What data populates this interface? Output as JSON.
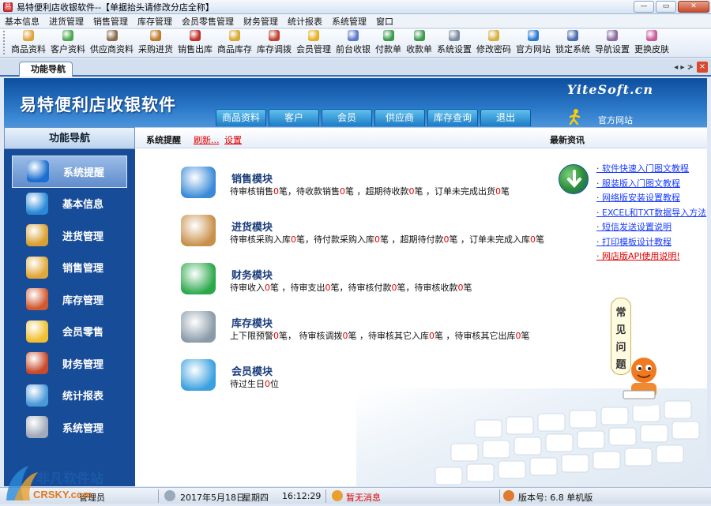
{
  "window": {
    "title": "易特便利店收银软件--【单据抬头请修改分店全称】",
    "controls": [
      "—",
      "▭",
      "✕"
    ]
  },
  "menubar": [
    "基本信息",
    "进货管理",
    "销售管理",
    "库存管理",
    "会员零售管理",
    "财务管理",
    "统计报表",
    "系统管理",
    "窗口"
  ],
  "toolbar": [
    {
      "label": "商品资料",
      "color": "#e2a23a"
    },
    {
      "label": "客户资料",
      "color": "#4aa84a"
    },
    {
      "label": "供应商资料",
      "color": "#8a6a4a"
    },
    {
      "label": "采购进货",
      "color": "#c07a2a"
    },
    {
      "label": "销售出库",
      "color": "#c0302a"
    },
    {
      "label": "商品库存",
      "color": "#d8a830"
    },
    {
      "label": "库存调拨",
      "color": "#c04030"
    },
    {
      "label": "会员管理",
      "color": "#e8b020"
    },
    {
      "label": "前台收银",
      "color": "#5a78c8"
    },
    {
      "label": "付款单",
      "color": "#3a9a4a"
    },
    {
      "label": "收款单",
      "color": "#3a9a4a"
    },
    {
      "label": "系统设置",
      "color": "#7a8aa0"
    },
    {
      "label": "修改密码",
      "color": "#d8b040"
    },
    {
      "label": "官方网站",
      "color": "#2a7ad0"
    },
    {
      "label": "锁定系统",
      "color": "#4a6ab0"
    },
    {
      "label": "导航设置",
      "color": "#8a6aa0"
    },
    {
      "label": "更换皮肤",
      "color": "#c85a9a"
    }
  ],
  "tab": {
    "label": "功能导航",
    "controls": "◂ ▸ ≯"
  },
  "header": {
    "brand": "易特便利店收银软件",
    "logo": "YiteSoft.cn",
    "tabs": [
      "商品资料",
      "客户",
      "会员",
      "供应商",
      "库存查询",
      "退出"
    ],
    "site_link": "官方网站"
  },
  "sidebar": {
    "title": "功能导航",
    "items": [
      {
        "label": "系统提醒",
        "icon": "info-icon",
        "active": true,
        "color": "#1a6fd0"
      },
      {
        "label": "基本信息",
        "icon": "cubes-icon",
        "active": false,
        "color": "#2a8ad8"
      },
      {
        "label": "进货管理",
        "icon": "box-icon",
        "active": false,
        "color": "#d8a030"
      },
      {
        "label": "销售管理",
        "icon": "box-icon",
        "active": false,
        "color": "#e0a838"
      },
      {
        "label": "库存管理",
        "icon": "house-icon",
        "active": false,
        "color": "#d05a30"
      },
      {
        "label": "会员零售",
        "icon": "chat-icon",
        "active": false,
        "color": "#f0c030"
      },
      {
        "label": "财务管理",
        "icon": "coins-icon",
        "active": false,
        "color": "#c84a2a"
      },
      {
        "label": "统计报表",
        "icon": "chart-icon",
        "active": false,
        "color": "#4a9ad8"
      },
      {
        "label": "系统管理",
        "icon": "gears-icon",
        "active": false,
        "color": "#a0aab8"
      }
    ]
  },
  "main": {
    "bar": {
      "title": "系统提醒",
      "refresh": "刷新...",
      "settings": "设置",
      "news_title": "最新资讯"
    },
    "modules": [
      {
        "title": "销售模块",
        "icon": "book-icon",
        "color": "#3a8ad8",
        "parts": [
          [
            "待审核销售",
            "0",
            "笔，待收款销售",
            "0",
            "笔 ，超期待收款",
            "0",
            "笔 ，订单未完成出货",
            "0",
            "笔"
          ]
        ]
      },
      {
        "title": "进货模块",
        "icon": "package-icon",
        "color": "#c8904a",
        "parts": [
          [
            "待审核采购入库",
            "0",
            "笔，待付款采购入库",
            "0",
            "笔 ，超期待付款",
            "0",
            "笔 ，订单未完成入库",
            "0",
            "笔"
          ]
        ]
      },
      {
        "title": "财务模块",
        "icon": "dollar-icon",
        "color": "#2aa84a",
        "parts": [
          [
            "待审收入",
            "0",
            "笔 ，待审支出",
            "0",
            "笔，待审核付款",
            "0",
            "笔，待审核收款",
            "0",
            "笔"
          ]
        ]
      },
      {
        "title": "库存模块",
        "icon": "database-icon",
        "color": "#8a9aa8",
        "parts": [
          [
            "上下限预警",
            "0",
            "笔，  待审核调拨",
            "0",
            "笔 ，待审核其它入库",
            "0",
            "笔 ，待审核其它出库",
            "0",
            "笔"
          ]
        ]
      },
      {
        "title": "会员模块",
        "icon": "chat-bubble-icon",
        "color": "#3aa0e0",
        "parts": [
          [
            "待过生日",
            "0",
            "位"
          ]
        ]
      }
    ],
    "news": [
      {
        "text": "软件快速入门图文教程",
        "red": false
      },
      {
        "text": "服装版入门图文教程",
        "red": false
      },
      {
        "text": "网络版安装设置教程",
        "red": false
      },
      {
        "text": "EXCEL和TXT数据导入方法",
        "red": false
      },
      {
        "text": "短信发送设置说明",
        "red": false
      },
      {
        "text": "打印模板设计教程",
        "red": false
      },
      {
        "text": "网店版API使用说明!",
        "red": true
      }
    ],
    "faq": [
      "常",
      "见",
      "问",
      "题"
    ]
  },
  "statusbar": {
    "operator": "管理员",
    "date": "2017年5月18日",
    "weekday": "星期四",
    "time": "16:12:29",
    "message": "暂无消息",
    "version": "版本号: 6.8 单机版"
  },
  "watermark": {
    "top": "非凡软件站",
    "bottom": "CRSKY.com"
  }
}
